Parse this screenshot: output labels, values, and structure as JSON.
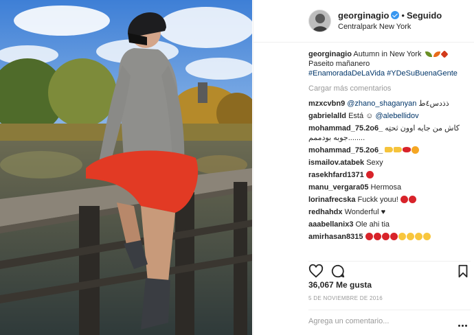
{
  "post": {
    "username": "georginagio",
    "follow_status": "Seguido",
    "separator": "•",
    "location": "Centralpark New York",
    "caption": {
      "username": "georginagio",
      "text": "Autumn in New York",
      "line2": "Paseito mañanero",
      "hashtags": "#EnamoradaDeLaVida #YDeSuBuenaGente"
    },
    "load_more": "Cargar más comentarios",
    "comments": [
      {
        "user": "mzxcvbn9",
        "mention": "@zhano_shaganyan",
        "text": "ذذدس٤ط"
      },
      {
        "user": "gabrielalld",
        "text": "Está ☺",
        "mention": "@alebellidov"
      },
      {
        "user": "mohammad_75.2o6_",
        "text": "كاش من جايه اوون ثحتِه",
        "line2": "جوبه بودممم........"
      },
      {
        "user": "mohammad_75.2o6_",
        "text": ""
      },
      {
        "user": "ismailov.atabek",
        "text": "Sexy"
      },
      {
        "user": "rasekhfard1371",
        "text": ""
      },
      {
        "user": "manu_vergara05",
        "text": "Hermosa"
      },
      {
        "user": "lorinafrecska",
        "text": "Fuckk youu!"
      },
      {
        "user": "redhahdx",
        "text": "Wonderful ♥"
      },
      {
        "user": "aaabellanix3",
        "text": "Ole ahi tia"
      },
      {
        "user": "amirhasan8315",
        "text": ""
      }
    ],
    "likes": "36,067 Me gusta",
    "date": "5 DE NOVIEMBRE DE 2016",
    "comment_placeholder": "Agrega un comentario...",
    "icons": {
      "like": "heart-outline-icon",
      "comment": "speech-bubble-icon",
      "save": "bookmark-icon",
      "more": "more-options-icon",
      "verified": "verified-badge-icon"
    },
    "colors": {
      "link": "#003569",
      "verified": "#3897f0",
      "muted": "#999999"
    }
  }
}
